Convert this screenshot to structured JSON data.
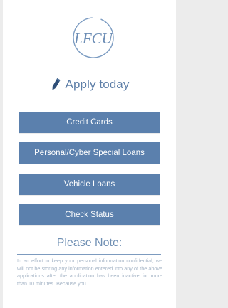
{
  "logo": {
    "text": "LFCU",
    "icon": "lfcu-circle-logo"
  },
  "apply": {
    "icon": "pencil-icon",
    "label": "Apply today"
  },
  "buttons": {
    "credit_cards": "Credit Cards",
    "personal_loans": "Personal/Cyber Special Loans",
    "vehicle_loans": "Vehicle Loans",
    "check_status": "Check Status"
  },
  "note": {
    "heading": "Please Note:",
    "body": "In an effort to keep your personal information confidential, we will not be storing any information entered into any of the above applications after the application has been inactive for more than 10 minutes. Because you"
  },
  "colors": {
    "accent": "#5b80ad",
    "heading": "#6f8fb3",
    "note_text": "#a7b6c7",
    "background": "#ececec"
  }
}
